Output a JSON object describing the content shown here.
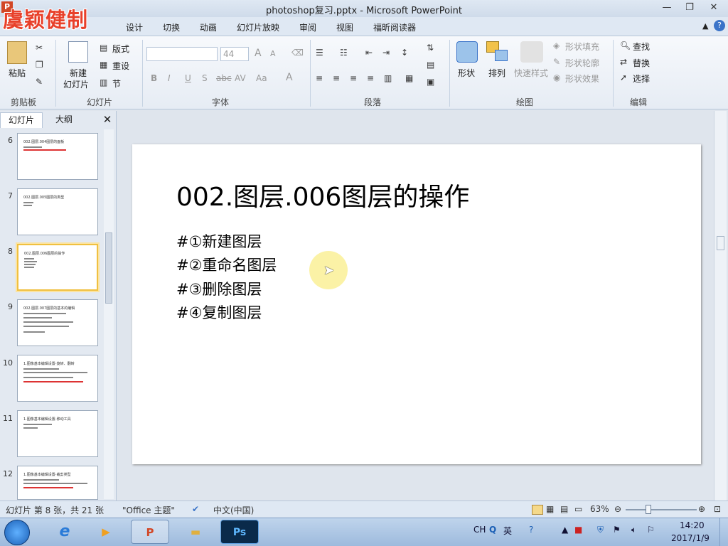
{
  "window": {
    "title": "photoshop复习.pptx - Microsoft PowerPoint",
    "app_icon": "P",
    "watermark": "虞颖健制",
    "controls": [
      "—",
      "❐",
      "✕"
    ]
  },
  "tabs": [
    "设计",
    "切换",
    "动画",
    "幻灯片放映",
    "审阅",
    "视图",
    "福昕阅读器"
  ],
  "ribbon": {
    "clipboard": {
      "paste": "粘贴",
      "label": "剪贴板"
    },
    "slides": {
      "new_slide_line1": "新建",
      "new_slide_line2": "幻灯片",
      "layout": "版式",
      "reset": "重设",
      "section": "节",
      "label": "幻灯片"
    },
    "font": {
      "size": "44",
      "label": "字体",
      "bold": "B",
      "italic": "I",
      "underline": "U",
      "shadow": "S",
      "strike": "abc",
      "spacing": "AV",
      "case": "Aa",
      "color": "A",
      "grow": "A",
      "shrink": "A"
    },
    "paragraph": {
      "label": "段落"
    },
    "drawing": {
      "shapes": "形状",
      "arrange": "排列",
      "quick_styles": "快速样式",
      "fill": "形状填充",
      "outline": "形状轮廓",
      "effects": "形状效果",
      "label": "绘图"
    },
    "editing": {
      "find": "查找",
      "replace": "替换",
      "select": "选择",
      "label": "编辑"
    }
  },
  "left_panel": {
    "tab_slides": "幻灯片",
    "tab_outline": "大纲",
    "close": "✕",
    "thumbnails": [
      {
        "num": "6",
        "title": "002.图层.004图层的面板"
      },
      {
        "num": "7",
        "title": "002.图层.005图层的类型"
      },
      {
        "num": "8",
        "title": "002.图层.006图层的操作"
      },
      {
        "num": "9",
        "title": "002.图层.007图层的基本的编辑"
      },
      {
        "num": "10",
        "title": "1.图像基本编辑设置-旋转、翻转"
      },
      {
        "num": "11",
        "title": "1.图像基本编辑设置-移动工具"
      },
      {
        "num": "12",
        "title": "1.图像基本编辑设置-裁剪类型"
      }
    ]
  },
  "slide": {
    "title": "002.图层.006图层的操作",
    "bullets": [
      "#①新建图层",
      "#②重命名图层",
      "#③删除图层",
      "#④复制图层"
    ]
  },
  "statusbar": {
    "slide_info": "幻灯片 第 8 张，共 21 张",
    "theme": "\"Office 主题\"",
    "language": "中文(中国)",
    "zoom": "63%",
    "zoom_level": 0.63
  },
  "taskbar": {
    "ps_label": "Ps",
    "ime": "CH",
    "ime_lang": "英",
    "time": "14:20",
    "date": "2017/1/9"
  }
}
